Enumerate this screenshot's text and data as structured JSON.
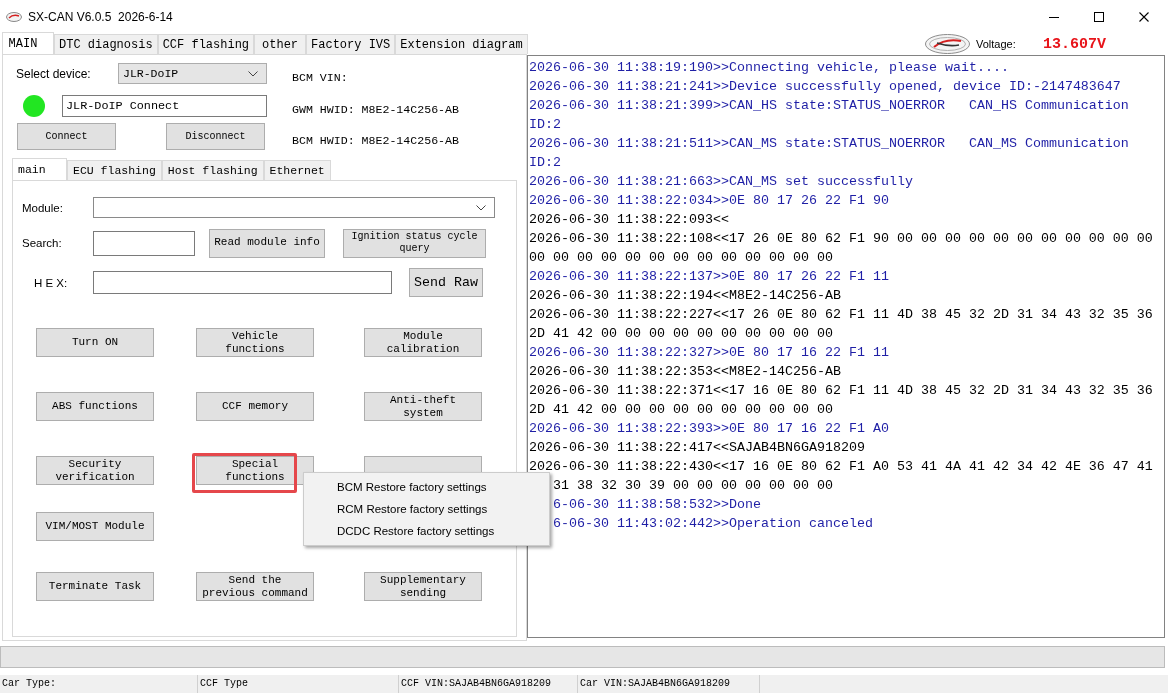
{
  "window": {
    "title": "SX-CAN V6.0.5  2026-6-14"
  },
  "tabs": [
    {
      "label": "MAIN",
      "selected": true
    },
    {
      "label": "DTC diagnosis",
      "selected": false
    },
    {
      "label": "CCF flashing",
      "selected": false
    },
    {
      "label": "other",
      "selected": false
    },
    {
      "label": "Factory IVS",
      "selected": false
    },
    {
      "label": "Extension diagram",
      "selected": false
    }
  ],
  "voltage": {
    "label": "Voltage:",
    "value": "13.607V"
  },
  "device": {
    "label": "Select device:",
    "value": "JLR-DoIP",
    "connected": true,
    "status": "JLR-DoIP Connect",
    "buttons": [
      "Connect",
      "Disconnect"
    ]
  },
  "vehicle_info": [
    "BCM VIN:",
    "GWM HWID: M8E2-14C256-AB",
    "BCM HWID: M8E2-14C256-AB"
  ],
  "sub_tabs": [
    {
      "label": "main",
      "selected": true
    },
    {
      "label": "ECU flashing",
      "selected": false
    },
    {
      "label": "Host flashing",
      "selected": false
    },
    {
      "label": "Ethernet",
      "selected": false
    }
  ],
  "module": {
    "label": "Module:"
  },
  "search": {
    "label": "Search:",
    "buttons": [
      "Read module info",
      "Ignition status cycle query"
    ]
  },
  "hex": {
    "label": "H E X:",
    "button": "Send Raw"
  },
  "function_buttons": [
    [
      {
        "label": "Turn ON",
        "highlighted": false
      },
      {
        "label": "Vehicle functions",
        "highlighted": false
      },
      {
        "label": "Module calibration",
        "highlighted": false
      }
    ],
    [
      {
        "label": "ABS functions",
        "highlighted": false
      },
      {
        "label": "CCF memory",
        "highlighted": false
      },
      {
        "label": "Anti-theft system",
        "highlighted": false
      }
    ],
    [
      {
        "label": "Security verification",
        "highlighted": false
      },
      {
        "label": "Special functions",
        "highlighted": true
      },
      {
        "highlighted": false
      }
    ],
    [
      {
        "label": "VIM/MOST Module",
        "highlighted": false
      }
    ],
    [
      {
        "label": "Terminate Task",
        "highlighted": false
      },
      {
        "label": "Send the previous command",
        "highlighted": false
      },
      {
        "label": "Supplementary sending",
        "highlighted": false
      }
    ]
  ],
  "context_menu": {
    "items": [
      {
        "label": "BCM Restore factory settings"
      },
      {
        "label": "RCM Restore factory settings"
      },
      {
        "label": "DCDC Restore factory settings"
      }
    ]
  },
  "log": [
    {
      "text": "2026-06-30 11:38:19:190>>Connecting vehicle, please wait....",
      "kind": "sent"
    },
    {
      "text": "2026-06-30 11:38:21:241>>Device successfully opened, device ID:-2147483647",
      "kind": "sent"
    },
    {
      "text": "2026-06-30 11:38:21:399>>CAN_HS state:STATUS_NOERROR   CAN_HS Communication",
      "kind": "sent"
    },
    {
      "text": "ID:2",
      "kind": "sent"
    },
    {
      "text": "2026-06-30 11:38:21:511>>CAN_MS state:STATUS_NOERROR   CAN_MS Communication",
      "kind": "sent"
    },
    {
      "text": "ID:2",
      "kind": "sent"
    },
    {
      "text": "2026-06-30 11:38:21:663>>CAN_MS set successfully",
      "kind": "sent"
    },
    {
      "text": "2026-06-30 11:38:22:034>>0E 80 17 26 22 F1 90",
      "kind": "sent"
    },
    {
      "text": "2026-06-30 11:38:22:093<<",
      "kind": "received"
    },
    {
      "text": "2026-06-30 11:38:22:108<<17 26 0E 80 62 F1 90 00 00 00 00 00 00 00 00 00 00 00",
      "kind": "received"
    },
    {
      "text": "00 00 00 00 00 00 00 00 00 00 00 00 00",
      "kind": "received"
    },
    {
      "text": "2026-06-30 11:38:22:137>>0E 80 17 26 22 F1 11",
      "kind": "sent"
    },
    {
      "text": "2026-06-30 11:38:22:194<<M8E2-14C256-AB",
      "kind": "received"
    },
    {
      "text": "2026-06-30 11:38:22:227<<17 26 0E 80 62 F1 11 4D 38 45 32 2D 31 34 43 32 35 36",
      "kind": "received"
    },
    {
      "text": "2D 41 42 00 00 00 00 00 00 00 00 00 00",
      "kind": "received"
    },
    {
      "text": "2026-06-30 11:38:22:327>>0E 80 17 16 22 F1 11",
      "kind": "sent"
    },
    {
      "text": "2026-06-30 11:38:22:353<<M8E2-14C256-AB",
      "kind": "received"
    },
    {
      "text": "2026-06-30 11:38:22:371<<17 16 0E 80 62 F1 11 4D 38 45 32 2D 31 34 43 32 35 36",
      "kind": "received"
    },
    {
      "text": "2D 41 42 00 00 00 00 00 00 00 00 00 00",
      "kind": "received"
    },
    {
      "text": "2026-06-30 11:38:22:393>>0E 80 17 16 22 F1 A0",
      "kind": "sent"
    },
    {
      "text": "2026-06-30 11:38:22:417<<SAJAB4BN6GA918209",
      "kind": "received"
    },
    {
      "text": "2026-06-30 11:38:22:430<<17 16 0E 80 62 F1 A0 53 41 4A 41 42 34 42 4E 36 47 41",
      "kind": "received"
    }
  ],
  "log_behind_menu": [
    {
      "text": "31 38 32 30 39 00 00 00 00 00 00 00",
      "kind": "received"
    },
    {
      "text": "6-06-30 11:38:58:532>>Done",
      "kind": "sent"
    },
    {
      "text": "6-06-30 11:43:02:442>>Operation canceled",
      "kind": "sent"
    }
  ],
  "status_bar": [
    "Car Type:",
    "CCF Type",
    "CCF VIN:SAJAB4BN6GA918209",
    "Car VIN:SAJAB4BN6GA918209"
  ]
}
